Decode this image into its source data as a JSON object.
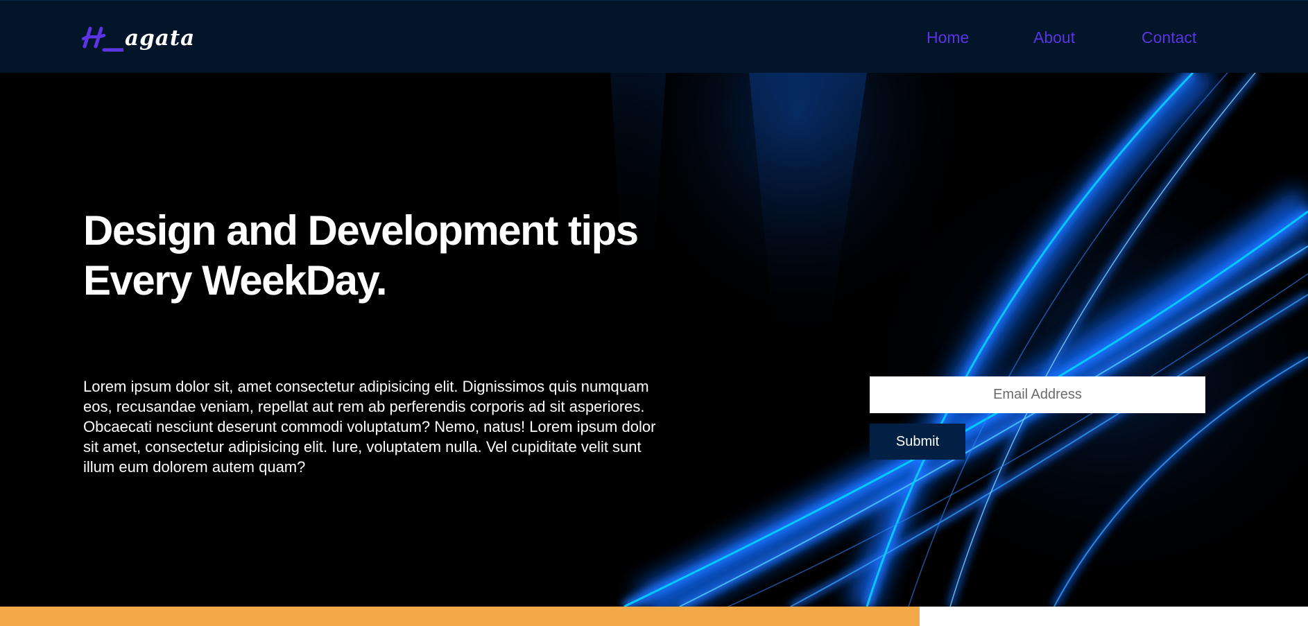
{
  "brand": {
    "logo_icon": "h-monogram-logo",
    "logo_text": "agata",
    "accent_color": "#5b35e3"
  },
  "nav": {
    "items": [
      {
        "label": "Home"
      },
      {
        "label": "About"
      },
      {
        "label": "Contact"
      }
    ]
  },
  "hero": {
    "headline_line1": "Design and Development tips",
    "headline_line2": "Every WeekDay.",
    "body": "Lorem ipsum dolor sit, amet consectetur adipisicing elit. Dignissimos quis numquam eos, recusandae veniam, repellat aut rem ab perferendis corporis ad sit asperiores. Obcaecati nesciunt deserunt commodi voluptatum? Nemo, natus! Lorem ipsum dolor sit amet, consectetur adipisicing elit. Iure, voluptatem nulla. Vel cupiditate velit sunt illum eum dolorem autem quam?",
    "background": "blue-light-streaks"
  },
  "form": {
    "email_placeholder": "Email Address",
    "submit_label": "Submit"
  },
  "colors": {
    "header_bg": "#021529",
    "hero_bg": "#000000",
    "button_bg": "#021f44",
    "streak_blue": "#1a73ff",
    "streak_cyan": "#00d4ff",
    "bottom_accent": "#f3a947"
  }
}
